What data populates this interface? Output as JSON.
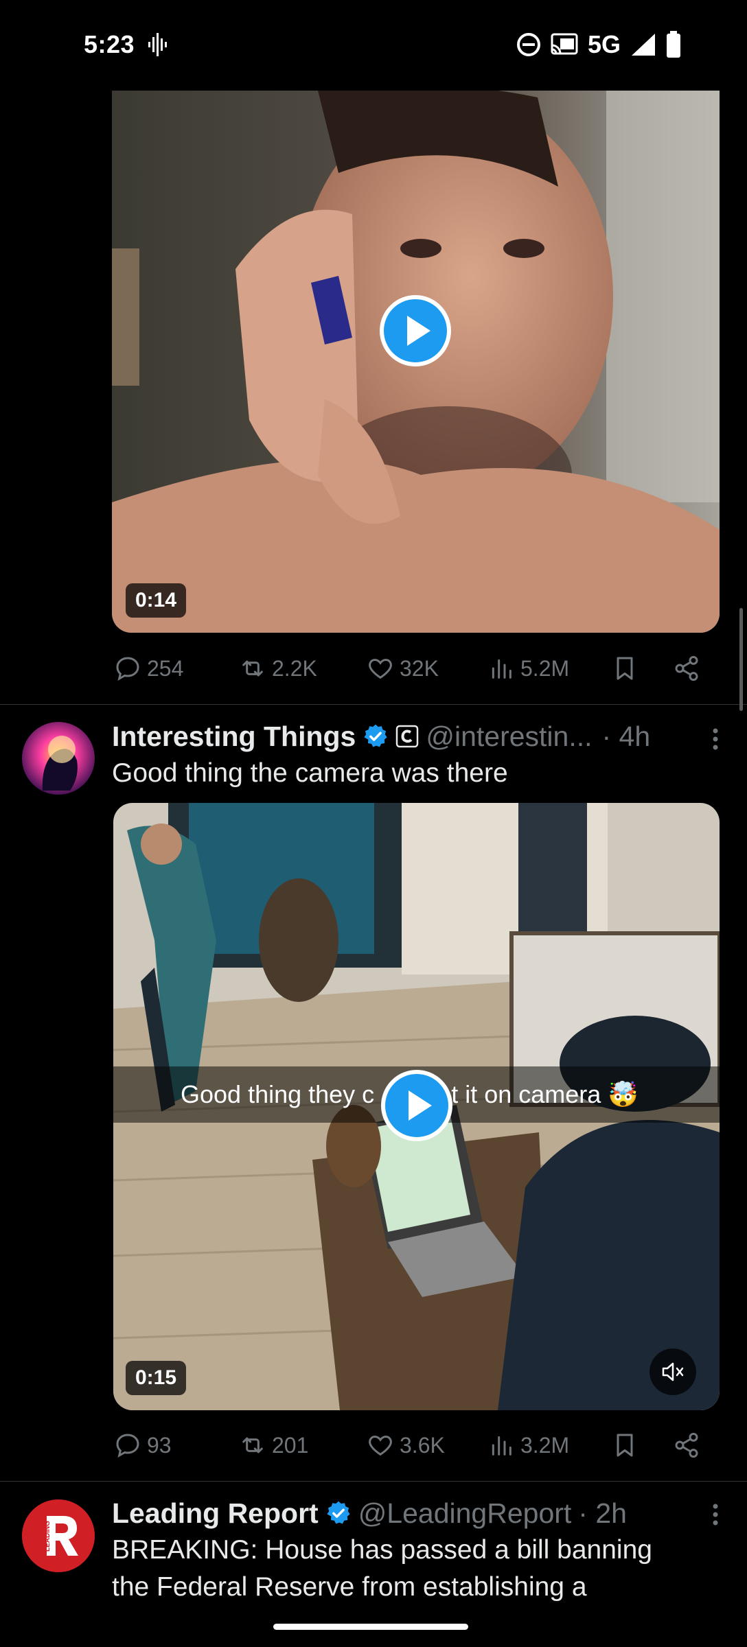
{
  "status_bar": {
    "time": "5:23",
    "network": "5G",
    "icons": [
      "voice-recording-icon",
      "do-not-disturb-icon",
      "cast-icon",
      "signal-icon",
      "battery-icon"
    ]
  },
  "tweet_1": {
    "video": {
      "duration": "0:14"
    },
    "stats": {
      "replies": "254",
      "reposts": "2.2K",
      "likes": "32K",
      "views": "5.2M"
    }
  },
  "tweet_2": {
    "author": "Interesting Things",
    "handle": "@interestin...",
    "time": "· 4h",
    "text": "Good thing the camera was there",
    "video": {
      "duration": "0:15",
      "caption_before": "Good thing they c",
      "caption_after": "t it on camera 🤯"
    },
    "stats": {
      "replies": "93",
      "reposts": "201",
      "likes": "3.6K",
      "views": "3.2M"
    }
  },
  "tweet_3": {
    "author": "Leading Report",
    "handle": "@LeadingReport",
    "time": "· 2h",
    "avatar_text": "LEADING",
    "text_line1": "BREAKING: House has passed a bill banning",
    "text_line2": "the Federal Reserve from establishing a"
  },
  "colors": {
    "accent": "#1d9bf0",
    "muted": "#71767b",
    "text": "#e7e9ea",
    "background": "#000000"
  }
}
